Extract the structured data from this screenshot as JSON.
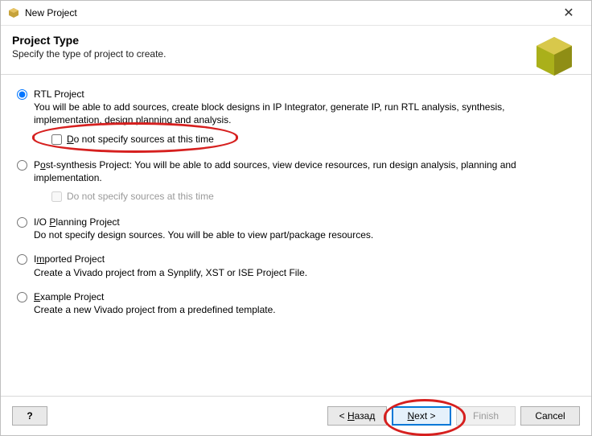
{
  "titlebar": {
    "title": "New Project"
  },
  "header": {
    "title": "Project Type",
    "subtitle": "Specify the type of project to create."
  },
  "options": {
    "rtl": {
      "title": "RTL Project",
      "desc": "You will be able to add sources, create block designs in IP Integrator, generate IP, run RTL analysis, synthesis, implementation, design planning and analysis.",
      "checkbox": "Do not specify sources at this time"
    },
    "postsynth": {
      "title": "Post-synthesis Project",
      "desc": ": You will be able to add sources, view device resources, run design analysis, planning and implementation.",
      "checkbox": "Do not specify sources at this time"
    },
    "io": {
      "title": "I/O Planning Project",
      "desc": "Do not specify design sources. You will be able to view part/package resources."
    },
    "imported": {
      "title": "Imported Project",
      "desc": "Create a Vivado project from a Synplify, XST or ISE Project File."
    },
    "example": {
      "title": "Example Project",
      "desc": "Create a new Vivado project from a predefined template."
    }
  },
  "footer": {
    "help": "?",
    "back_prefix": "< ",
    "back_label": "Назад",
    "next_label": "Next",
    "next_suffix": " >",
    "finish": "Finish",
    "cancel": "Cancel"
  }
}
